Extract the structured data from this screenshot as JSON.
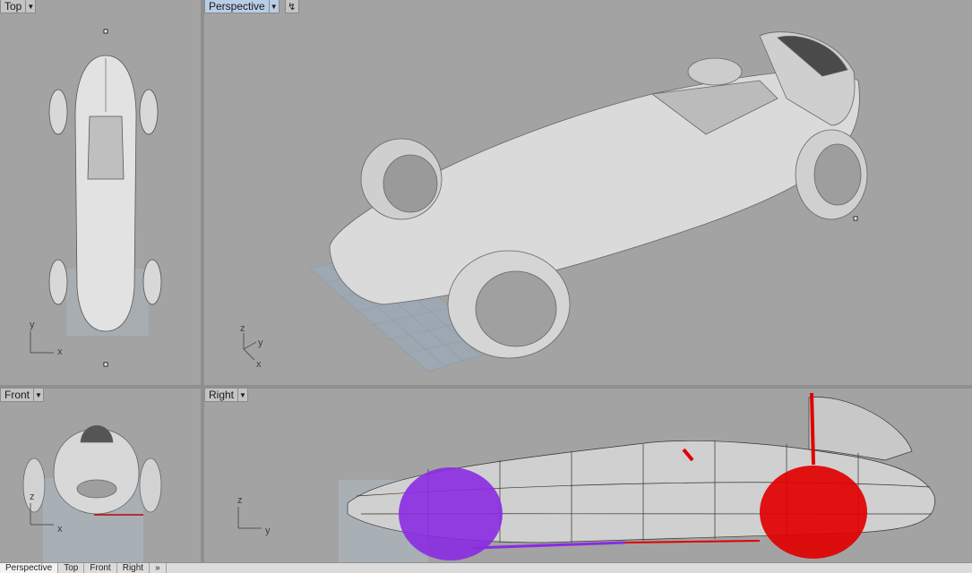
{
  "viewports": {
    "top": {
      "label": "Top",
      "active": false
    },
    "perspective": {
      "label": "Perspective",
      "active": true
    },
    "front": {
      "label": "Front",
      "active": false
    },
    "right": {
      "label": "Right",
      "active": false
    }
  },
  "axes": {
    "top": {
      "a": "y",
      "b": "x"
    },
    "perspective": {
      "a": "z",
      "b": "y",
      "c": "x"
    },
    "front": {
      "a": "z",
      "b": "x"
    },
    "right": {
      "a": "z",
      "b": "y"
    }
  },
  "bottom_tabs": [
    "Perspective",
    "Top",
    "Front",
    "Right",
    "»"
  ],
  "colors": {
    "viewport_bg": "#a3a3a3",
    "active_label": "#b8cde6",
    "purple_mesh": "#8a2be2",
    "red_mesh": "#e00000"
  },
  "icons": {
    "dropdown": "chevron-down-icon",
    "viewport_tool": "viewport-tool-icon"
  }
}
